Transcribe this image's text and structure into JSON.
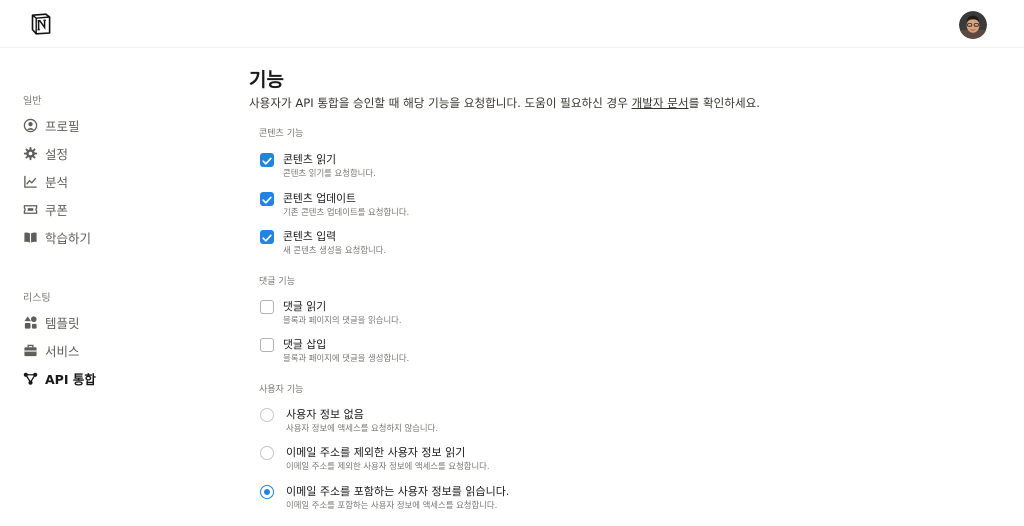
{
  "header": {
    "logo_icon": "notion-logo-icon",
    "avatar_icon": "user-avatar"
  },
  "sidebar": {
    "sections": [
      {
        "label": "일반",
        "items": [
          {
            "label": "프로필",
            "icon": "user-circle-icon"
          },
          {
            "label": "설정",
            "icon": "gear-icon"
          },
          {
            "label": "분석",
            "icon": "chart-line-icon"
          },
          {
            "label": "쿠폰",
            "icon": "ticket-icon"
          },
          {
            "label": "학습하기",
            "icon": "book-open-icon"
          }
        ]
      },
      {
        "label": "리스팅",
        "items": [
          {
            "label": "템플릿",
            "icon": "shapes-icon"
          },
          {
            "label": "서비스",
            "icon": "briefcase-icon"
          },
          {
            "label": "API 통합",
            "icon": "network-icon",
            "active": true
          }
        ]
      }
    ]
  },
  "main": {
    "title": "기능",
    "description_before": "사용자가 API 통합을 승인할 때 해당 기능을 요청합니다. 도움이 필요하신 경우 ",
    "description_link": "개발자 문서",
    "description_after": "를 확인하세요.",
    "groups": [
      {
        "label": "콘텐츠 기능",
        "type": "checkbox",
        "options": [
          {
            "title": "콘텐츠 읽기",
            "subtitle": "콘텐츠 읽기를 요청합니다.",
            "checked": true
          },
          {
            "title": "콘텐츠 업데이트",
            "subtitle": "기존 콘텐츠 업데이트를 요청합니다.",
            "checked": true
          },
          {
            "title": "콘텐츠 입력",
            "subtitle": "새 콘텐츠 생성을 요청합니다.",
            "checked": true
          }
        ]
      },
      {
        "label": "댓글 기능",
        "type": "checkbox",
        "options": [
          {
            "title": "댓글 읽기",
            "subtitle": "블록과 페이지의 댓글을 읽습니다.",
            "checked": false
          },
          {
            "title": "댓글 삽입",
            "subtitle": "블록과 페이지에 댓글을 생성합니다.",
            "checked": false
          }
        ]
      },
      {
        "label": "사용자 기능",
        "type": "radio",
        "options": [
          {
            "title": "사용자 정보 없음",
            "subtitle": "사용자 정보에 액세스를 요청하지 않습니다.",
            "checked": false
          },
          {
            "title": "이메일 주소를 제외한 사용자 정보 읽기",
            "subtitle": "이메일 주소를 제외한 사용자 정보에 액세스를 요청합니다.",
            "checked": false
          },
          {
            "title": "이메일 주소를 포함하는 사용자 정보를 읽습니다.",
            "subtitle": "이메일 주소를 포함하는 사용자 정보에 액세스를 요청합니다.",
            "checked": true
          }
        ]
      }
    ]
  },
  "colors": {
    "accent": "#2383e2",
    "text": "#37352f",
    "muted": "#787774"
  }
}
